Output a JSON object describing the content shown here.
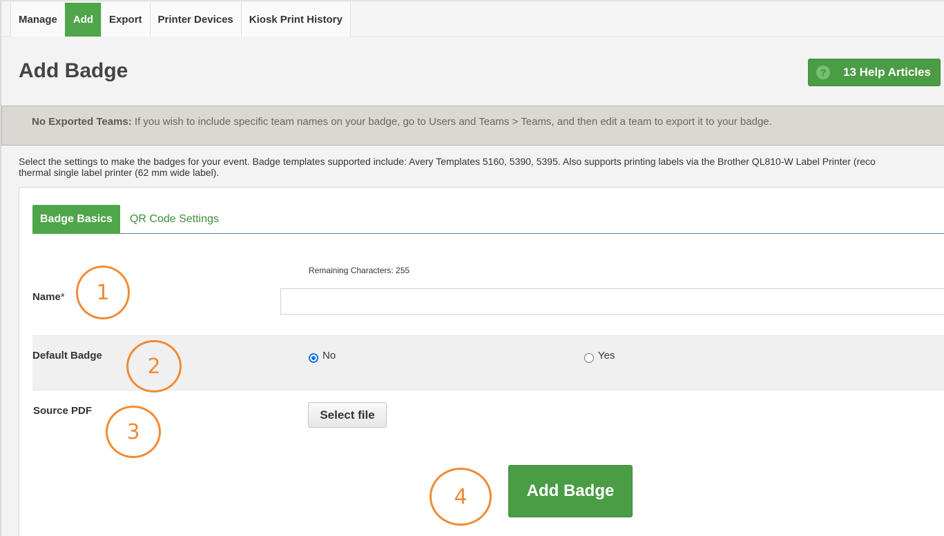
{
  "top_tabs": [
    "Manage",
    "Add",
    "Export",
    "Printer Devices",
    "Kiosk Print History"
  ],
  "active_top_tab": "Add",
  "page_title": "Add Badge",
  "help_button": {
    "label": "13 Help Articles",
    "icon": "question-icon"
  },
  "notice": {
    "bold": "No Exported Teams:",
    "text": " If you wish to include specific team names on your badge, go to Users and Teams > Teams, and then edit a team to export it to your badge."
  },
  "intro": {
    "line1": "Select the settings to make the badges for your event.  Badge templates supported include:  Avery Templates 5160, 5390, 5395.  Also supports printing labels via the Brother QL810-W Label Printer (reco",
    "line2": "thermal single label printer (62 mm wide label)."
  },
  "form_tabs": [
    "Badge Basics",
    "QR Code Settings"
  ],
  "form": {
    "remaining": "Remaining Characters: 255",
    "name_label": "Name",
    "required_mark": "*",
    "name_value": "",
    "default_badge_label": "Default Badge",
    "option_no": "No",
    "option_yes": "Yes",
    "default_badge_selected": "No",
    "source_pdf_label": "Source PDF",
    "select_file_label": "Select file",
    "submit_label": "Add Badge"
  },
  "callouts": [
    "1",
    "2",
    "3",
    "4"
  ],
  "colors": {
    "green": "#4ea54a",
    "callout": "#f08a32",
    "notice_bg": "#dbd8d4"
  }
}
